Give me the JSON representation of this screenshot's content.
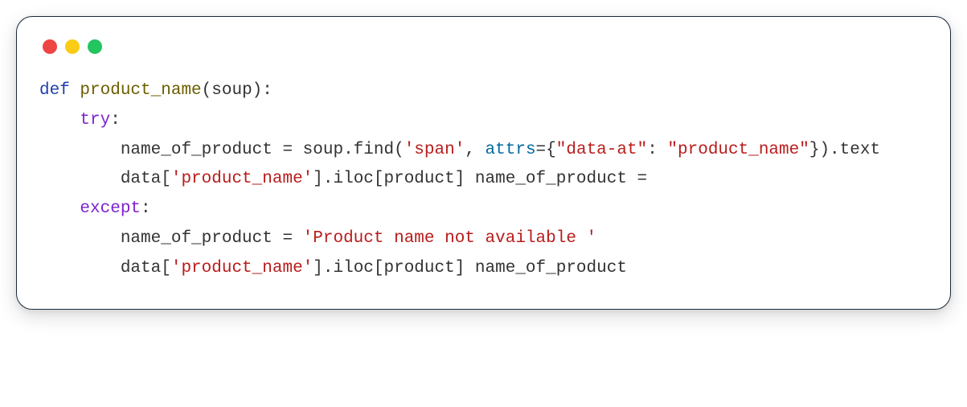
{
  "traffic_lights": {
    "red": "#ef4444",
    "yellow": "#facc15",
    "green": "#22c55e"
  },
  "code": {
    "lang": "python",
    "tokens": {
      "t01": "def",
      "t02": " ",
      "t03": "product_name",
      "t04": "(soup):",
      "t05": "\n    ",
      "t06": "try",
      "t07": ":",
      "t08": "\n        name_of_product = soup.find(",
      "t09": "'span'",
      "t10": ", ",
      "t11": "attrs",
      "t12": "={",
      "t13": "\"data-at\"",
      "t14": ": ",
      "t15": "\"product_name\"",
      "t16": "}).text",
      "t17": "\n        data[",
      "t18": "'product_name'",
      "t19": "].iloc[product] name_of_product = ",
      "t20": "\n    ",
      "t21": "except",
      "t22": ":",
      "t23": "\n        name_of_product = ",
      "t24": "'Product name not available '",
      "t25": "\n        data[",
      "t26": "'product_name'",
      "t27": "].iloc[product] name_of_product"
    }
  }
}
